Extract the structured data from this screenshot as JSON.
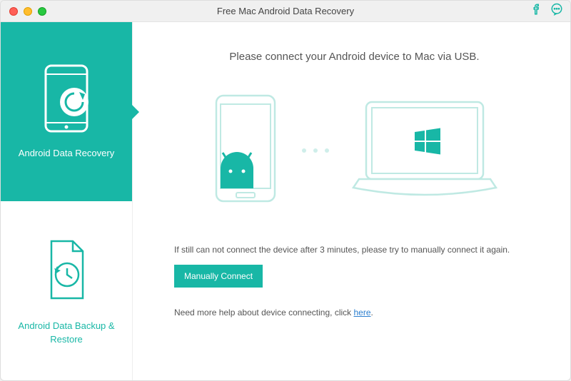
{
  "window": {
    "title": "Free Mac Android Data Recovery"
  },
  "sidebar": {
    "items": [
      {
        "label": "Android Data Recovery"
      },
      {
        "label": "Android Data Backup & Restore"
      }
    ]
  },
  "main": {
    "headline": "Please connect your Android device to Mac via USB.",
    "hint": "If still can not connect the device after 3 minutes, please try to manually connect it again.",
    "manual_button": "Manually Connect",
    "help_prefix": "Need more help about device connecting, click ",
    "help_link": "here",
    "help_suffix": "."
  },
  "colors": {
    "accent": "#18b7a6"
  }
}
